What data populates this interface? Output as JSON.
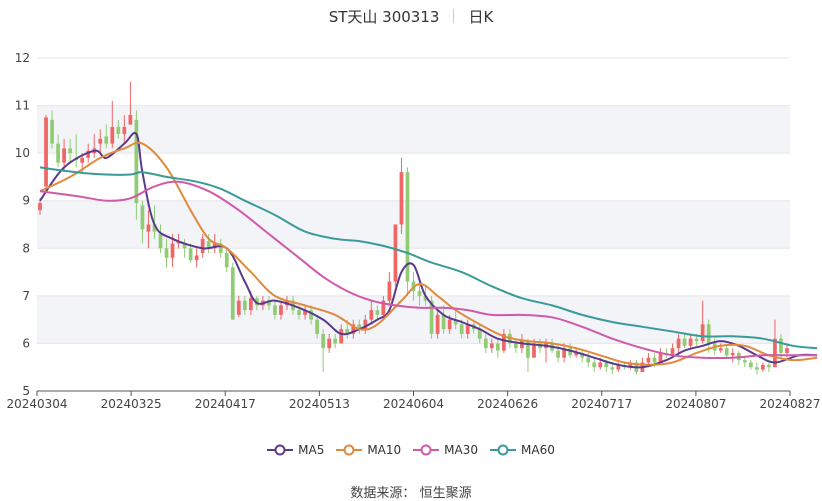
{
  "title": {
    "name": "ST天山 300313",
    "period": "日K"
  },
  "source": {
    "label": "数据来源：",
    "name": "恒生聚源"
  },
  "colors": {
    "up": "#ee6666",
    "down": "#91cc75",
    "grid": "#e6e6e6",
    "band": "#f3f4f8"
  },
  "chart_data": {
    "type": "candlestick",
    "ylim": [
      5,
      12
    ],
    "yticks": [
      5,
      6,
      7,
      8,
      9,
      10,
      11,
      12
    ],
    "xticks": [
      "20240304",
      "20240325",
      "20240417",
      "20240513",
      "20240604",
      "20240626",
      "20240717",
      "20240807",
      "20240827"
    ],
    "candles": [
      [
        8.8,
        8.95,
        9.05,
        8.7
      ],
      [
        9.3,
        10.75,
        10.8,
        9.2
      ],
      [
        10.7,
        10.2,
        10.9,
        10.1
      ],
      [
        10.2,
        9.8,
        10.4,
        9.7
      ],
      [
        9.8,
        10.1,
        10.3,
        9.6
      ],
      [
        10.1,
        10.0,
        10.3,
        9.8
      ],
      [
        9.9,
        9.85,
        10.4,
        9.7
      ],
      [
        9.8,
        9.9,
        10.0,
        9.6
      ],
      [
        9.9,
        10.05,
        10.2,
        9.8
      ],
      [
        10.0,
        10.1,
        10.4,
        9.9
      ],
      [
        10.2,
        10.3,
        10.5,
        10.0
      ],
      [
        10.35,
        10.2,
        10.6,
        10.1
      ],
      [
        10.2,
        10.55,
        11.1,
        10.1
      ],
      [
        10.55,
        10.4,
        10.7,
        10.3
      ],
      [
        10.4,
        10.55,
        10.8,
        10.2
      ],
      [
        10.6,
        10.8,
        11.5,
        10.6
      ],
      [
        10.7,
        8.95,
        10.9,
        8.6
      ],
      [
        8.9,
        8.4,
        9.0,
        8.1
      ],
      [
        8.35,
        8.5,
        8.8,
        8.0
      ],
      [
        8.5,
        8.35,
        8.9,
        8.2
      ],
      [
        8.3,
        8.0,
        8.5,
        7.9
      ],
      [
        8.0,
        7.8,
        8.2,
        7.6
      ],
      [
        7.8,
        8.1,
        8.3,
        7.6
      ],
      [
        8.1,
        8.15,
        8.3,
        8.0
      ],
      [
        8.1,
        8.0,
        8.2,
        7.8
      ],
      [
        8.0,
        7.75,
        8.1,
        7.7
      ],
      [
        7.75,
        7.85,
        8.0,
        7.6
      ],
      [
        7.9,
        8.2,
        8.3,
        7.8
      ],
      [
        8.15,
        8.0,
        8.3,
        7.9
      ],
      [
        8.0,
        8.1,
        8.3,
        7.9
      ],
      [
        8.1,
        7.9,
        8.2,
        7.8
      ],
      [
        7.9,
        7.6,
        8.0,
        7.5
      ],
      [
        7.6,
        6.5,
        7.7,
        6.5
      ],
      [
        6.6,
        6.9,
        7.0,
        6.55
      ],
      [
        6.9,
        6.7,
        7.0,
        6.6
      ],
      [
        6.7,
        6.95,
        7.1,
        6.6
      ],
      [
        6.95,
        6.8,
        7.0,
        6.7
      ],
      [
        6.8,
        6.9,
        7.0,
        6.7
      ],
      [
        6.9,
        6.8,
        7.0,
        6.7
      ],
      [
        6.8,
        6.6,
        6.9,
        6.5
      ],
      [
        6.6,
        6.8,
        6.9,
        6.5
      ],
      [
        6.8,
        6.9,
        7.0,
        6.7
      ],
      [
        6.9,
        6.7,
        7.0,
        6.6
      ],
      [
        6.7,
        6.6,
        6.8,
        6.5
      ],
      [
        6.6,
        6.7,
        6.8,
        6.5
      ],
      [
        6.7,
        6.5,
        6.8,
        6.4
      ],
      [
        6.5,
        6.2,
        6.6,
        6.1
      ],
      [
        6.2,
        5.9,
        6.3,
        5.4
      ],
      [
        5.9,
        6.1,
        6.2,
        5.8
      ],
      [
        6.1,
        6.0,
        6.2,
        5.9
      ],
      [
        6.0,
        6.3,
        6.4,
        6.0
      ],
      [
        6.3,
        6.2,
        6.5,
        6.1
      ],
      [
        6.2,
        6.4,
        6.5,
        6.1
      ],
      [
        6.4,
        6.3,
        6.5,
        6.2
      ],
      [
        6.3,
        6.5,
        6.6,
        6.2
      ],
      [
        6.5,
        6.7,
        6.9,
        6.4
      ],
      [
        6.7,
        6.6,
        6.8,
        6.5
      ],
      [
        6.6,
        6.9,
        7.0,
        6.5
      ],
      [
        6.9,
        7.3,
        7.5,
        6.8
      ],
      [
        7.3,
        8.5,
        8.5,
        7.2
      ],
      [
        8.5,
        9.6,
        9.9,
        8.3
      ],
      [
        9.6,
        7.3,
        9.7,
        7.0
      ],
      [
        7.3,
        7.1,
        7.5,
        6.9
      ],
      [
        7.1,
        7.0,
        7.3,
        6.8
      ],
      [
        7.0,
        6.9,
        7.2,
        6.8
      ],
      [
        6.9,
        6.2,
        7.0,
        6.1
      ],
      [
        6.2,
        6.6,
        6.7,
        6.1
      ],
      [
        6.6,
        6.3,
        6.8,
        6.2
      ],
      [
        6.3,
        6.5,
        6.6,
        6.2
      ],
      [
        6.5,
        6.4,
        6.7,
        6.3
      ],
      [
        6.4,
        6.2,
        6.5,
        6.1
      ],
      [
        6.2,
        6.4,
        6.5,
        6.1
      ],
      [
        6.4,
        6.3,
        6.5,
        6.2
      ],
      [
        6.3,
        6.1,
        6.4,
        6.0
      ],
      [
        6.1,
        5.9,
        6.2,
        5.8
      ],
      [
        5.9,
        6.0,
        6.1,
        5.8
      ],
      [
        6.0,
        5.85,
        6.1,
        5.7
      ],
      [
        5.85,
        6.2,
        6.3,
        5.8
      ],
      [
        6.2,
        6.0,
        6.3,
        5.9
      ],
      [
        6.0,
        5.9,
        6.1,
        5.8
      ],
      [
        5.9,
        6.05,
        6.2,
        5.8
      ],
      [
        6.05,
        5.7,
        6.1,
        5.4
      ],
      [
        5.7,
        6.0,
        6.1,
        5.7
      ],
      [
        6.0,
        5.9,
        6.1,
        5.8
      ],
      [
        5.9,
        6.0,
        6.1,
        5.6
      ],
      [
        6.0,
        5.85,
        6.1,
        5.8
      ],
      [
        5.85,
        5.7,
        5.95,
        5.6
      ],
      [
        5.7,
        5.9,
        6.0,
        5.6
      ],
      [
        5.9,
        5.75,
        6.0,
        5.7
      ],
      [
        5.75,
        5.8,
        5.9,
        5.7
      ],
      [
        5.8,
        5.7,
        5.85,
        5.6
      ],
      [
        5.7,
        5.6,
        5.8,
        5.5
      ],
      [
        5.6,
        5.5,
        5.7,
        5.4
      ],
      [
        5.5,
        5.6,
        5.7,
        5.45
      ],
      [
        5.6,
        5.5,
        5.65,
        5.4
      ],
      [
        5.5,
        5.45,
        5.6,
        5.35
      ],
      [
        5.45,
        5.55,
        5.6,
        5.4
      ],
      [
        5.55,
        5.5,
        5.6,
        5.45
      ],
      [
        5.5,
        5.6,
        5.65,
        5.45
      ],
      [
        5.6,
        5.4,
        5.65,
        5.35
      ],
      [
        5.4,
        5.6,
        5.7,
        5.4
      ],
      [
        5.6,
        5.7,
        5.8,
        5.5
      ],
      [
        5.7,
        5.6,
        5.8,
        5.5
      ],
      [
        5.6,
        5.8,
        5.9,
        5.6
      ],
      [
        5.8,
        5.75,
        5.9,
        5.7
      ],
      [
        5.75,
        5.9,
        6.0,
        5.7
      ],
      [
        5.9,
        6.1,
        6.2,
        5.8
      ],
      [
        6.1,
        5.95,
        6.2,
        5.9
      ],
      [
        5.95,
        6.1,
        6.2,
        5.9
      ],
      [
        6.1,
        6.05,
        6.2,
        5.95
      ],
      [
        6.05,
        6.4,
        6.9,
        6.0
      ],
      [
        6.4,
        6.0,
        6.5,
        5.8
      ],
      [
        6.0,
        5.85,
        6.1,
        5.75
      ],
      [
        5.85,
        5.9,
        6.0,
        5.8
      ],
      [
        5.9,
        5.75,
        5.95,
        5.7
      ],
      [
        5.75,
        5.8,
        5.9,
        5.6
      ],
      [
        5.8,
        5.65,
        5.85,
        5.55
      ],
      [
        5.65,
        5.6,
        5.7,
        5.5
      ],
      [
        5.6,
        5.5,
        5.65,
        5.45
      ],
      [
        5.5,
        5.45,
        5.6,
        5.35
      ],
      [
        5.45,
        5.55,
        5.6,
        5.4
      ],
      [
        5.55,
        5.5,
        5.6,
        5.4
      ],
      [
        5.5,
        6.1,
        6.5,
        5.5
      ],
      [
        6.1,
        5.8,
        6.2,
        5.7
      ],
      [
        5.8,
        5.9,
        6.0,
        5.7
      ]
    ],
    "series": [
      {
        "name": "MA5",
        "color": "#5b3a8c",
        "values": [
          [
            0,
            9.0
          ],
          [
            4,
            9.7
          ],
          [
            9,
            10.05
          ],
          [
            11,
            9.9
          ],
          [
            14,
            10.2
          ],
          [
            16,
            10.4
          ],
          [
            17,
            9.6
          ],
          [
            19,
            8.5
          ],
          [
            22,
            8.2
          ],
          [
            27,
            8.0
          ],
          [
            31,
            8.0
          ],
          [
            34,
            7.3
          ],
          [
            36,
            6.85
          ],
          [
            39,
            6.9
          ],
          [
            43,
            6.75
          ],
          [
            47,
            6.5
          ],
          [
            50,
            6.2
          ],
          [
            53,
            6.3
          ],
          [
            56,
            6.5
          ],
          [
            58,
            6.7
          ],
          [
            60,
            7.5
          ],
          [
            62,
            7.65
          ],
          [
            64,
            7.0
          ],
          [
            67,
            6.6
          ],
          [
            70,
            6.45
          ],
          [
            73,
            6.3
          ],
          [
            76,
            6.1
          ],
          [
            80,
            6.0
          ],
          [
            84,
            5.95
          ],
          [
            88,
            5.85
          ],
          [
            92,
            5.7
          ],
          [
            96,
            5.55
          ],
          [
            100,
            5.5
          ],
          [
            104,
            5.65
          ],
          [
            107,
            5.85
          ],
          [
            110,
            5.95
          ],
          [
            113,
            6.05
          ],
          [
            116,
            5.95
          ],
          [
            119,
            5.75
          ],
          [
            122,
            5.6
          ],
          [
            126,
            5.75
          ],
          [
            129,
            5.75
          ]
        ]
      },
      {
        "name": "MA10",
        "color": "#e08a3c",
        "values": [
          [
            0,
            9.2
          ],
          [
            5,
            9.5
          ],
          [
            10,
            9.9
          ],
          [
            14,
            10.1
          ],
          [
            17,
            10.2
          ],
          [
            21,
            9.7
          ],
          [
            25,
            8.8
          ],
          [
            28,
            8.2
          ],
          [
            31,
            8.0
          ],
          [
            35,
            7.5
          ],
          [
            39,
            7.0
          ],
          [
            44,
            6.8
          ],
          [
            49,
            6.6
          ],
          [
            53,
            6.3
          ],
          [
            56,
            6.4
          ],
          [
            60,
            6.9
          ],
          [
            63,
            7.25
          ],
          [
            66,
            7.0
          ],
          [
            69,
            6.7
          ],
          [
            73,
            6.4
          ],
          [
            77,
            6.15
          ],
          [
            81,
            6.05
          ],
          [
            85,
            6.0
          ],
          [
            89,
            5.9
          ],
          [
            93,
            5.75
          ],
          [
            97,
            5.6
          ],
          [
            101,
            5.55
          ],
          [
            105,
            5.6
          ],
          [
            109,
            5.8
          ],
          [
            113,
            5.95
          ],
          [
            117,
            5.95
          ],
          [
            121,
            5.75
          ],
          [
            125,
            5.65
          ],
          [
            129,
            5.7
          ]
        ]
      },
      {
        "name": "MA30",
        "color": "#d05aa9",
        "values": [
          [
            0,
            9.2
          ],
          [
            6,
            9.1
          ],
          [
            11,
            9.0
          ],
          [
            15,
            9.05
          ],
          [
            19,
            9.3
          ],
          [
            23,
            9.4
          ],
          [
            28,
            9.2
          ],
          [
            33,
            8.8
          ],
          [
            38,
            8.3
          ],
          [
            43,
            7.8
          ],
          [
            47,
            7.4
          ],
          [
            51,
            7.1
          ],
          [
            55,
            6.9
          ],
          [
            59,
            6.8
          ],
          [
            63,
            6.75
          ],
          [
            67,
            6.75
          ],
          [
            71,
            6.7
          ],
          [
            75,
            6.6
          ],
          [
            80,
            6.6
          ],
          [
            85,
            6.55
          ],
          [
            90,
            6.35
          ],
          [
            95,
            6.1
          ],
          [
            100,
            5.9
          ],
          [
            105,
            5.75
          ],
          [
            110,
            5.7
          ],
          [
            115,
            5.7
          ],
          [
            120,
            5.75
          ],
          [
            125,
            5.75
          ],
          [
            129,
            5.75
          ]
        ]
      },
      {
        "name": "MA60",
        "color": "#3a9a9a",
        "values": [
          [
            0,
            9.7
          ],
          [
            6,
            9.6
          ],
          [
            11,
            9.55
          ],
          [
            15,
            9.55
          ],
          [
            17,
            9.6
          ],
          [
            21,
            9.5
          ],
          [
            26,
            9.4
          ],
          [
            30,
            9.25
          ],
          [
            34,
            9.0
          ],
          [
            39,
            8.7
          ],
          [
            44,
            8.35
          ],
          [
            49,
            8.2
          ],
          [
            53,
            8.15
          ],
          [
            57,
            8.05
          ],
          [
            61,
            7.9
          ],
          [
            65,
            7.7
          ],
          [
            70,
            7.5
          ],
          [
            75,
            7.2
          ],
          [
            80,
            6.95
          ],
          [
            85,
            6.8
          ],
          [
            90,
            6.6
          ],
          [
            95,
            6.45
          ],
          [
            100,
            6.35
          ],
          [
            105,
            6.25
          ],
          [
            110,
            6.15
          ],
          [
            115,
            6.15
          ],
          [
            120,
            6.1
          ],
          [
            125,
            5.95
          ],
          [
            129,
            5.9
          ]
        ]
      }
    ]
  }
}
